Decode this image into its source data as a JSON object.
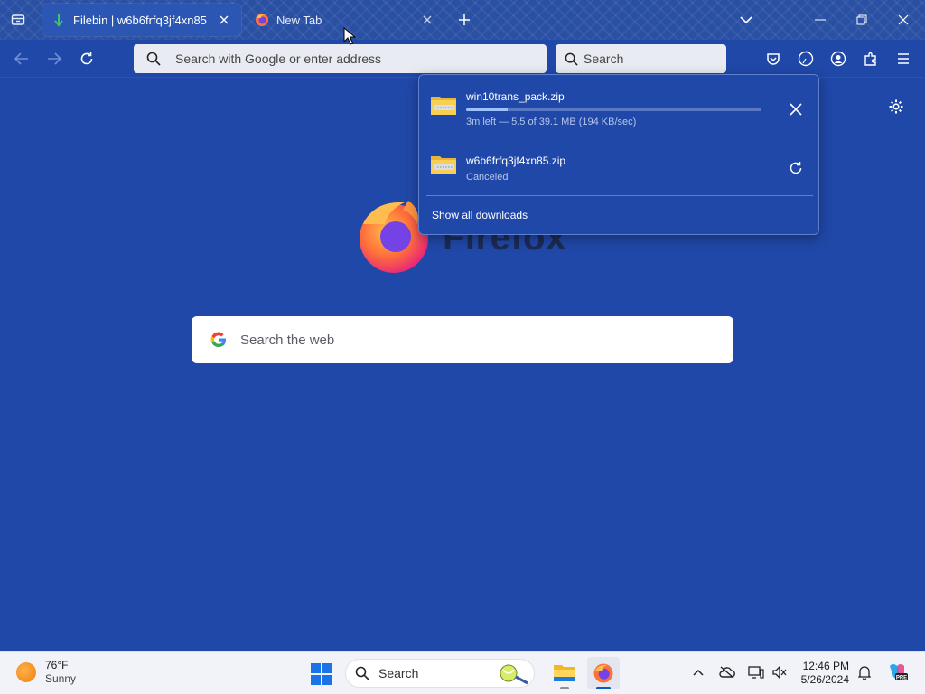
{
  "browser": {
    "tabs": [
      {
        "title": "Filebin | w6b6frfq3jf4xn85",
        "active": true,
        "icon": "download-arrow-icon"
      },
      {
        "title": "New Tab",
        "active": false,
        "icon": "firefox-icon"
      }
    ],
    "urlbar": {
      "placeholder": "Search with Google or enter address"
    },
    "searchbar": {
      "placeholder": "Search"
    }
  },
  "newtab": {
    "brand": "Firefox",
    "web_search_placeholder": "Search the web"
  },
  "downloads": {
    "items": [
      {
        "filename": "win10trans_pack.zip",
        "status": "3m left — 5.5 of 39.1 MB (194 KB/sec)",
        "progress": 0.14,
        "action": "cancel"
      },
      {
        "filename": "w6b6frfq3jf4xn85.zip",
        "status": "Canceled",
        "action": "retry"
      }
    ],
    "show_all_label": "Show all downloads"
  },
  "taskbar": {
    "weather": {
      "temp": "76°F",
      "condition": "Sunny"
    },
    "search_label": "Search",
    "clock": {
      "time": "12:46 PM",
      "date": "5/26/2024"
    }
  },
  "colors": {
    "accent": "#2048a8",
    "progress": "#9ec2ff"
  }
}
